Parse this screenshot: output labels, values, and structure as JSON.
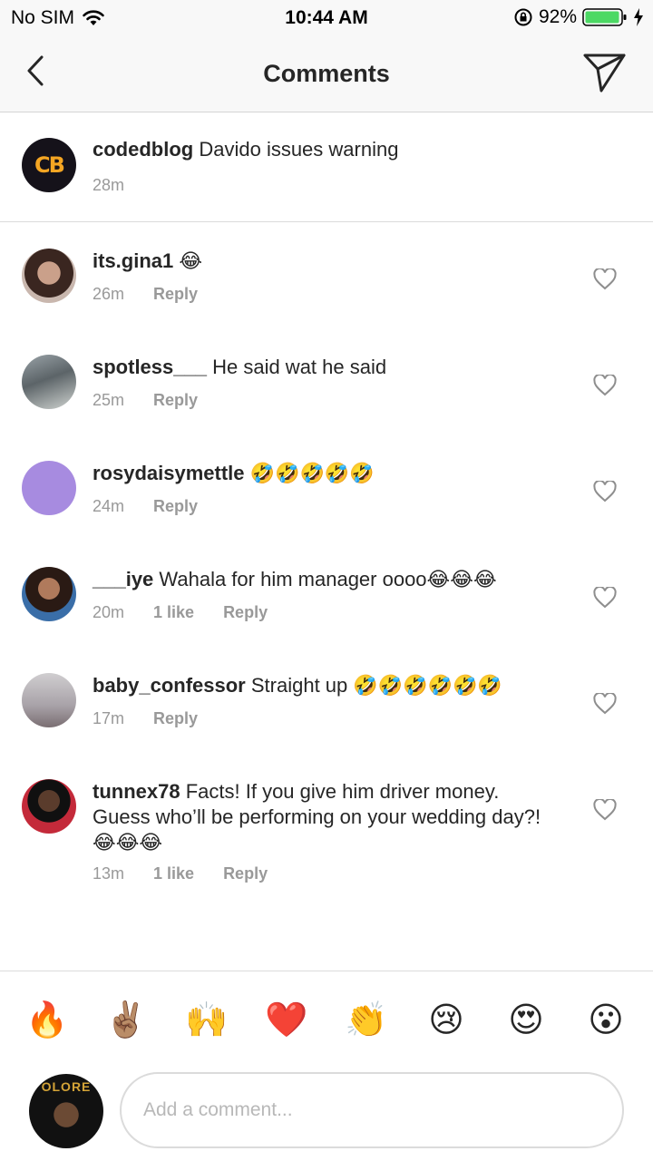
{
  "status_bar": {
    "carrier": "No SIM",
    "time": "10:44 AM",
    "battery": "92%"
  },
  "nav": {
    "title": "Comments"
  },
  "caption": {
    "username": "codedblog",
    "text": "Davido issues warning",
    "time": "28m",
    "avatar_text": "CB"
  },
  "comments": [
    {
      "username": "its.gina1",
      "text": "😂",
      "time": "26m",
      "likes": "",
      "reply": "Reply"
    },
    {
      "username": "spotless___",
      "text": "He said wat he said",
      "time": "25m",
      "likes": "",
      "reply": "Reply"
    },
    {
      "username": "rosydaisymettle",
      "text": "🤣🤣🤣🤣🤣",
      "time": "24m",
      "likes": "",
      "reply": "Reply"
    },
    {
      "username": "___iye",
      "text": "Wahala for him manager oooo😂😂😂",
      "time": "20m",
      "likes": "1 like",
      "reply": "Reply"
    },
    {
      "username": "baby_confessor",
      "text": "Straight up 🤣🤣🤣🤣🤣🤣",
      "time": "17m",
      "likes": "",
      "reply": "Reply"
    },
    {
      "username": "tunnex78",
      "text": "Facts! If you give him driver money. Guess who’ll be performing on your wedding day?! 😂😂😂",
      "time": "13m",
      "likes": "1 like",
      "reply": "Reply"
    }
  ],
  "emoji_bar": [
    "🔥",
    "✌🏽",
    "🙌",
    "❤️",
    "👏",
    "😢",
    "😍",
    "😮"
  ],
  "input": {
    "placeholder": "Add a comment...",
    "avatar_text": "OLORE"
  },
  "colors": {
    "text": "#262626",
    "meta": "#999999",
    "accent_cb": "#f5a623",
    "battery": "#4cd964"
  }
}
